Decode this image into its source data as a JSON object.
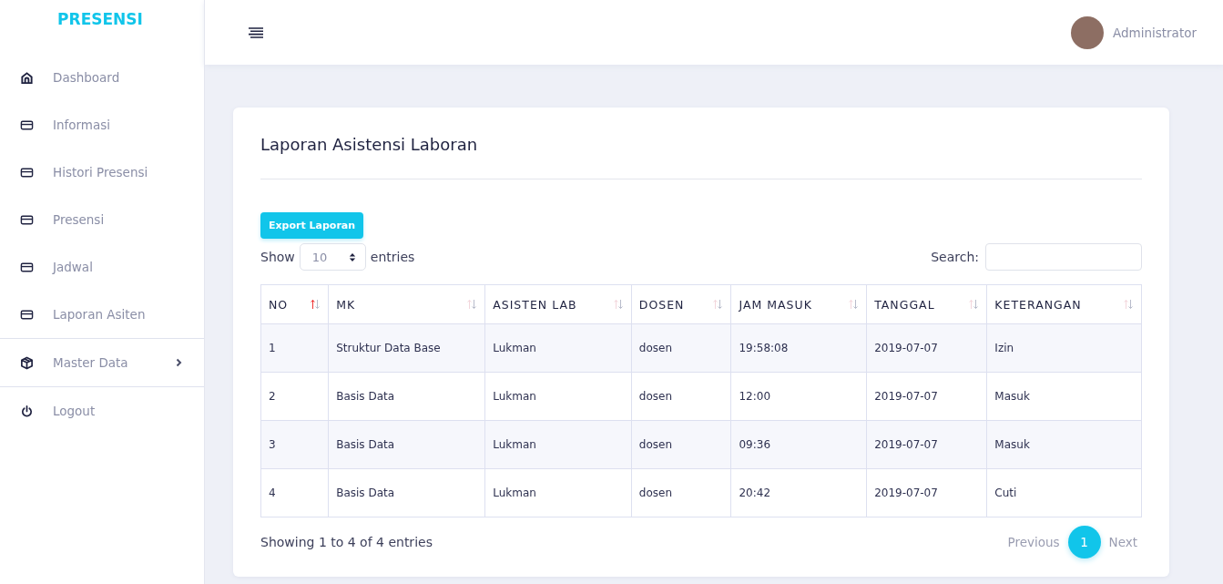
{
  "brand": "PRESENSI",
  "sidebar": {
    "items": [
      {
        "label": "Dashboard",
        "kind": "link"
      },
      {
        "label": "Informasi",
        "kind": "link"
      },
      {
        "label": "Histori Presensi",
        "kind": "link"
      },
      {
        "label": "Presensi",
        "kind": "link"
      },
      {
        "label": "Jadwal",
        "kind": "link"
      },
      {
        "label": "Laporan Asiten",
        "kind": "link"
      },
      {
        "label": "Master Data",
        "kind": "group",
        "expanded": false
      },
      {
        "label": "Logout",
        "kind": "link"
      }
    ]
  },
  "header": {
    "user": "Administrator"
  },
  "card": {
    "title": "Laporan Asistensi Laboran",
    "export_button": "Export Laporan",
    "length": {
      "before": "Show",
      "value": "10",
      "after": "entries"
    },
    "search": {
      "label": "Search:"
    },
    "table": {
      "columns": [
        {
          "label": "NO",
          "sorted": true
        },
        {
          "label": "MK",
          "sorted": false
        },
        {
          "label": "ASISTEN LAB",
          "sorted": false
        },
        {
          "label": "DOSEN",
          "sorted": false
        },
        {
          "label": "JAM MASUK",
          "sorted": false
        },
        {
          "label": "TANGGAL",
          "sorted": false
        },
        {
          "label": "KETERANGAN",
          "sorted": false
        }
      ],
      "rows": [
        [
          "1",
          "Struktur Data Base",
          "Lukman",
          "dosen",
          "19:58:08",
          "2019-07-07",
          "Izin"
        ],
        [
          "2",
          "Basis Data",
          "Lukman",
          "dosen",
          "12:00",
          "2019-07-07",
          "Masuk"
        ],
        [
          "3",
          "Basis Data",
          "Lukman",
          "dosen",
          "09:36",
          "2019-07-07",
          "Masuk"
        ],
        [
          "4",
          "Basis Data",
          "Lukman",
          "dosen",
          "20:42",
          "2019-07-07",
          "Cuti"
        ]
      ]
    },
    "info": "Showing 1 to 4 of 4 entries",
    "pagination": [
      {
        "label": "Previous",
        "selected": false
      },
      {
        "label": "1",
        "selected": true
      },
      {
        "label": "Next",
        "selected": false
      }
    ]
  }
}
